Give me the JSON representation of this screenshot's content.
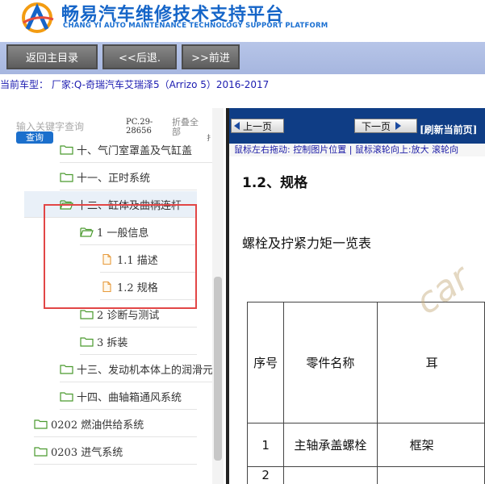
{
  "header": {
    "title_cn": "畅易汽车维修技术支持平台",
    "title_en": "CHANG YI AUTO MAINTENANCE TECHNOLOGY SUPPORT PLATFORM"
  },
  "toolbar": {
    "home": "返回主目录",
    "back": "<<后退.",
    "forward": ">>前进"
  },
  "vehicle": "当前车型： 厂家:Q-奇瑞汽车艾瑞泽5（Arrizo 5）2016-2017",
  "sidebar": {
    "search_placeholder": "输入关键字查询",
    "query_btn": "查询",
    "pc_code": "PC.29-28656",
    "fold_all": "折叠全部",
    "tick": "扌",
    "tree": [
      {
        "label": "十、气门室罩盖及气缸盖",
        "type": "folder"
      },
      {
        "label": "十一、正时系统",
        "type": "folder"
      },
      {
        "label": "十二、缸体及曲柄连杆",
        "type": "folder-open"
      },
      {
        "label": "1 一般信息",
        "type": "folder-open"
      },
      {
        "label": "1.1 描述",
        "type": "file"
      },
      {
        "label": "1.2 规格",
        "type": "file"
      },
      {
        "label": "2 诊断与测试",
        "type": "folder"
      },
      {
        "label": "3 拆装",
        "type": "folder"
      },
      {
        "label": "十三、发动机本体上的润滑元",
        "type": "folder"
      },
      {
        "label": "十四、曲轴箱通风系统",
        "type": "folder"
      },
      {
        "label": "0202 燃油供给系统",
        "type": "folder"
      },
      {
        "label": "0203 进气系统",
        "type": "folder"
      }
    ]
  },
  "content": {
    "prev": "上一页",
    "next": "下一页",
    "refresh": "[刷新当前页]",
    "hint": "鼠标左右拖动: 控制图片位置 | 鼠标滚轮向上:放大  滚轮向",
    "title": "1.2、规格",
    "subtitle": "螺栓及拧紧力矩一览表",
    "table": {
      "headers": [
        "序号",
        "零件名称",
        "耳"
      ],
      "rows": [
        [
          "1",
          "主轴承盖螺栓",
          "框架"
        ],
        [
          "2",
          "",
          ""
        ]
      ]
    },
    "watermark": "car"
  },
  "colors": {
    "brand_blue": "#1565c8",
    "toolbar_bg": "#a9b8e0",
    "nav_dark": "#0f3d85",
    "highlight": "#e24646"
  }
}
